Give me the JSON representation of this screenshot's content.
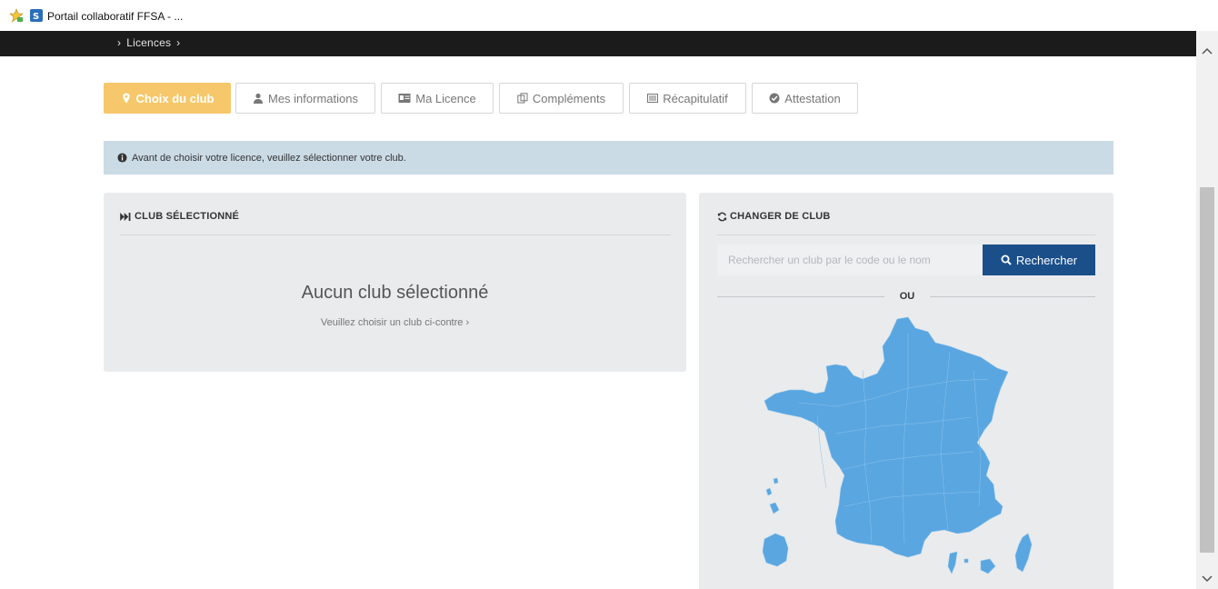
{
  "browser": {
    "tab_title": "Portail collaboratif FFSA - ..."
  },
  "navbar": {
    "breadcrumb": "Licences"
  },
  "steps": [
    {
      "label": "Choix du club",
      "icon": "map-marker-icon",
      "active": true
    },
    {
      "label": "Mes informations",
      "icon": "user-icon",
      "active": false
    },
    {
      "label": "Ma Licence",
      "icon": "id-card-icon",
      "active": false
    },
    {
      "label": "Compléments",
      "icon": "copy-icon",
      "active": false
    },
    {
      "label": "Récapitulatif",
      "icon": "list-icon",
      "active": false
    },
    {
      "label": "Attestation",
      "icon": "check-circle-icon",
      "active": false
    }
  ],
  "info": {
    "message": "Avant de choisir votre licence, veuillez sélectionner votre club."
  },
  "selected_club": {
    "heading": "CLUB SÉLECTIONNÉ",
    "empty_title": "Aucun club sélectionné",
    "empty_hint": "Veuillez choisir un club ci-contre ›"
  },
  "change_club": {
    "heading": "CHANGER DE CLUB",
    "search_placeholder": "Rechercher un club par le code ou le nom",
    "search_button": "Rechercher",
    "or_label": "OU"
  },
  "colors": {
    "active_step": "#f6c86b",
    "primary_button": "#1b4f8a",
    "map_fill": "#5aa6e0",
    "info_banner": "#cbdbe6",
    "navbar": "#1b1b1b"
  }
}
